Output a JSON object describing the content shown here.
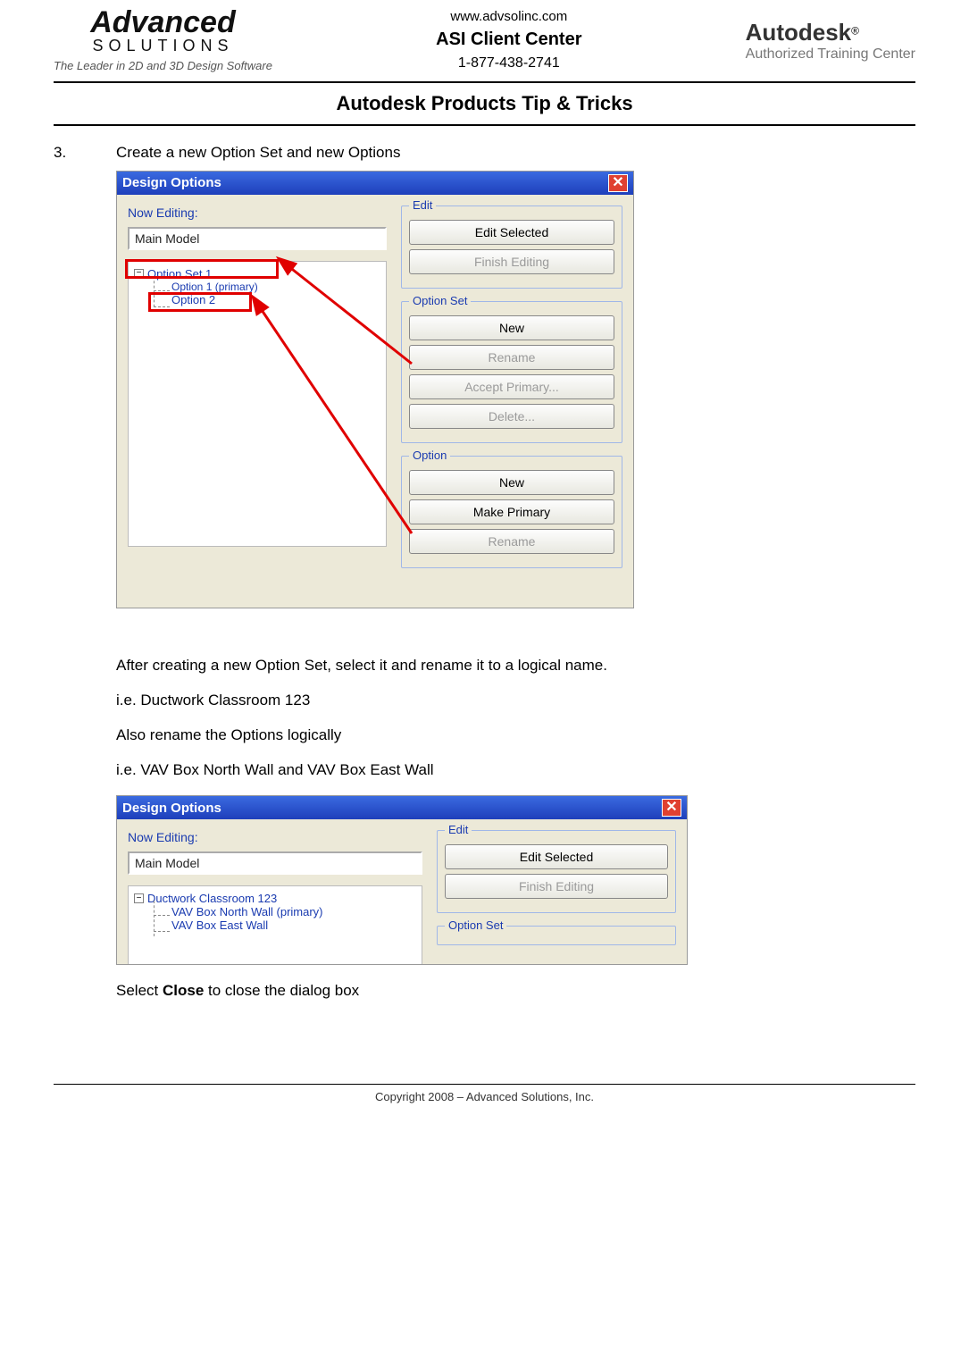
{
  "header": {
    "logoLeft": {
      "big": "Advanced",
      "solutions": "SOLUTIONS",
      "tagline": "The Leader in 2D and 3D Design Software"
    },
    "center": {
      "url": "www.advsolinc.com",
      "client": "ASI Client Center",
      "phone": "1-877-438-2741"
    },
    "logoRight": {
      "brand": "Autodesk",
      "reg": "®",
      "sub": "Authorized Training Center"
    }
  },
  "pageTitle": "Autodesk Products Tip & Tricks",
  "step": {
    "number": "3.",
    "text": "Create a new Option Set and new Options"
  },
  "dialog1": {
    "title": "Design Options",
    "nowEditingLabel": "Now Editing:",
    "nowEditingValue": "Main Model",
    "tree": {
      "set": "Option Set 1",
      "opt1": "Option 1 (primary)",
      "opt2": "Option 2"
    },
    "groups": {
      "edit": {
        "legend": "Edit",
        "editSelected": "Edit Selected",
        "finishEditing": "Finish Editing"
      },
      "optionSet": {
        "legend": "Option Set",
        "new": "New",
        "rename": "Rename",
        "acceptPrimary": "Accept Primary...",
        "delete": "Delete..."
      },
      "option": {
        "legend": "Option",
        "new": "New",
        "makePrimary": "Make Primary",
        "rename": "Rename"
      }
    }
  },
  "midText": {
    "p1": "After creating a new Option Set, select it and rename it to a logical name.",
    "p2": "i.e. Ductwork Classroom 123",
    "p3": "Also rename the Options logically",
    "p4": "i.e. VAV Box North Wall and VAV Box East Wall"
  },
  "dialog2": {
    "title": "Design Options",
    "nowEditingLabel": "Now Editing:",
    "nowEditingValue": "Main Model",
    "tree": {
      "set": "Ductwork Classroom 123",
      "opt1": "VAV Box North Wall (primary)",
      "opt2": "VAV Box East Wall"
    },
    "groups": {
      "edit": {
        "legend": "Edit",
        "editSelected": "Edit Selected",
        "finishEditing": "Finish Editing"
      },
      "optionSet": {
        "legend": "Option Set"
      }
    }
  },
  "closing": {
    "pre": "Select ",
    "bold": "Close",
    "post": " to close the dialog box"
  },
  "footer": "Copyright 2008 – Advanced Solutions, Inc."
}
